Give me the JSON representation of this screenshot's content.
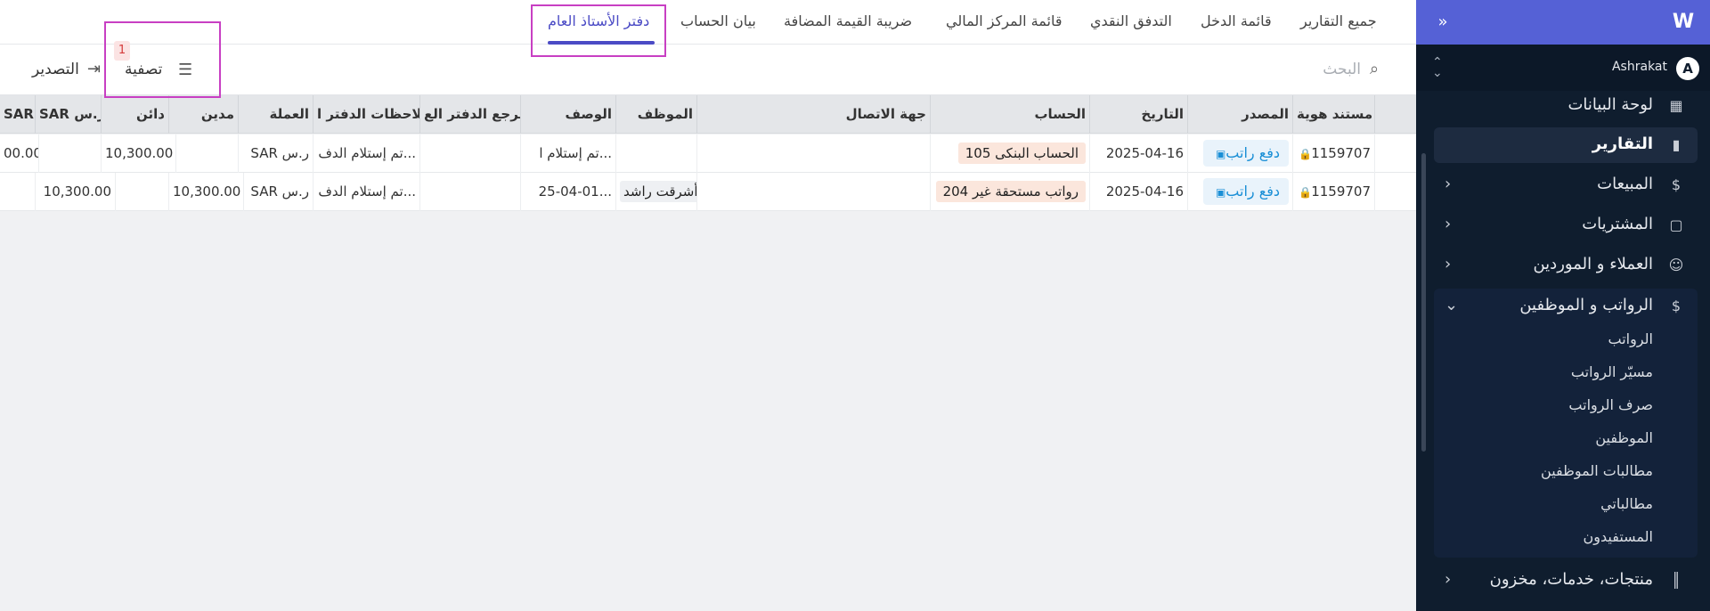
{
  "sidebar": {
    "user": {
      "name": "Ashrakat",
      "initial": "A"
    },
    "items": [
      {
        "label": "لوحة البيانات",
        "icon": "dashboard-icon"
      },
      {
        "label": "التقارير",
        "icon": "reports-icon"
      },
      {
        "label": "المبيعات",
        "icon": "dollar-icon"
      },
      {
        "label": "المشتريات",
        "icon": "shopping-bag-icon"
      },
      {
        "label": "العملاء و الموردين",
        "icon": "contacts-icon"
      },
      {
        "label": "الرواتب و الموظفين",
        "icon": "payroll-icon"
      },
      {
        "label": "منتجات، خدمات، مخزون",
        "icon": "barcode-icon"
      }
    ],
    "payroll_sub": [
      "الرواتب",
      "مسيّر الرواتب",
      "صرف الرواتب",
      "الموظفين",
      "مطالبات الموظفين",
      "مطالباتي",
      "المستفيدون"
    ]
  },
  "tabs": [
    "جميع التقارير",
    "قائمة الدخل",
    "التدفق النقدي",
    "قائمة المركز المالي",
    "ضريبة القيمة المضافة",
    "بيان الحساب",
    "دفتر الأستاذ العام"
  ],
  "toolbar": {
    "search_placeholder": "البحث",
    "filter_label": "تصفية",
    "filter_count": "1",
    "export_label": "التصدير"
  },
  "table": {
    "headers": [
      "مستند هوية",
      "المصدر",
      "التاريخ",
      "الحساب",
      "جهة الاتصال",
      "الموظف",
      "الوصف",
      "مرجع الدفتر الع",
      "ملاحظات الدفتر ا",
      "العملة",
      "مدين",
      "دائن",
      "SAR ر.س",
      "SAR"
    ],
    "rows": [
      [
        "1159707",
        "دفع راتب",
        "2025-04-16",
        "105 الحساب البنكى",
        "",
        "",
        "تم إستلام ا...",
        "",
        "تم إستلام الدف...",
        "SAR ر.س",
        "",
        "10,300.00",
        "",
        "00.00"
      ],
      [
        "1159707",
        "دفع راتب",
        "2025-04-16",
        "204 رواتب مستحقة غير",
        "",
        "أشرقت راشد",
        "25-04-01...",
        "",
        "تم إستلام الدف...",
        "SAR ر.س",
        "10,300.00",
        "",
        "10,300.00",
        ""
      ]
    ]
  }
}
